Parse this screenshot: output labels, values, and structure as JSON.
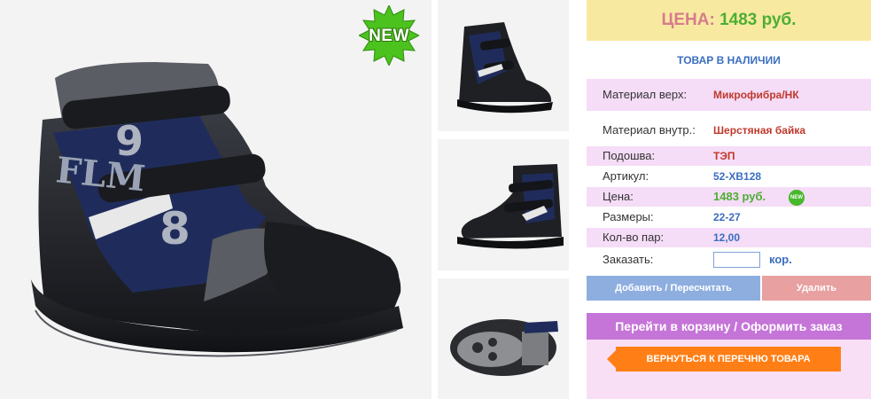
{
  "badges": {
    "new": "NEW",
    "mini_new": "NEW"
  },
  "price": {
    "label": "ЦЕНА:",
    "value": "1483 руб."
  },
  "stock_status": "ТОВАР В НАЛИЧИИ",
  "specs": {
    "material_top": {
      "label": "Материал верх:",
      "value": "Микрофибра/НК"
    },
    "material_inner": {
      "label": "Материал внутр.:",
      "value": "Шерстяная байка"
    },
    "sole": {
      "label": "Подошва:",
      "value": "ТЭП"
    },
    "article": {
      "label": "Артикул:",
      "value": "52-XB128"
    },
    "price": {
      "label": "Цена:",
      "value": "1483 руб."
    },
    "sizes": {
      "label": "Размеры:",
      "value": "22-27"
    },
    "pairs": {
      "label": "Кол-во пар:",
      "value": "12,00"
    },
    "order": {
      "label": "Заказать:",
      "input_value": "",
      "unit": "кор."
    }
  },
  "buttons": {
    "add": "Добавить / Пересчитать",
    "delete": "Удалить",
    "to_cart": "Перейти в корзину / Оформить заказ",
    "back": "ВЕРНУТЬСЯ К ПЕРЕЧНЮ ТОВАРА"
  },
  "shoe_print": {
    "letters": "FLM",
    "numbers": [
      "9",
      "8"
    ]
  },
  "colors": {
    "price_label": "#d77b8c",
    "price_value": "#4cae33",
    "stock": "#3a6ec0",
    "add_button": "#8eaee0",
    "delete_button": "#e8a0a0",
    "cart_button": "#c574d8",
    "back_button": "#ff7f16"
  }
}
